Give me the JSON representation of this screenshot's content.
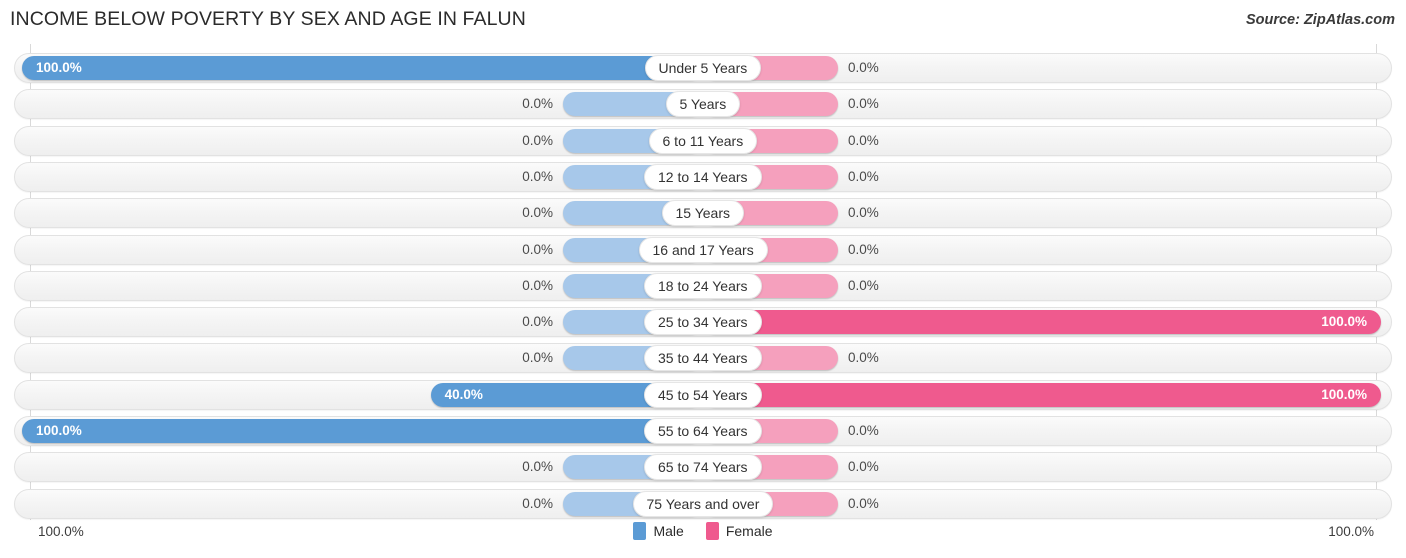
{
  "header": {
    "title": "INCOME BELOW POVERTY BY SEX AND AGE IN FALUN",
    "source": "Source: ZipAtlas.com"
  },
  "footer": {
    "axis_min_label": "100.0%",
    "axis_max_label": "100.0%",
    "legend": [
      {
        "label": "Male",
        "color": "#5b9bd5"
      },
      {
        "label": "Female",
        "color": "#ef5a8e"
      }
    ]
  },
  "chart_data": {
    "type": "bar",
    "title": "INCOME BELOW POVERTY BY SEX AND AGE IN FALUN",
    "subtitle": "Source: ZipAtlas.com",
    "orientation": "horizontal-diverging",
    "xlabel": "",
    "ylabel": "",
    "xlim": [
      100.0,
      100.0
    ],
    "grid": false,
    "legend_position": "bottom-center",
    "categories": [
      "Under 5 Years",
      "5 Years",
      "6 to 11 Years",
      "12 to 14 Years",
      "15 Years",
      "16 and 17 Years",
      "18 to 24 Years",
      "25 to 34 Years",
      "35 to 44 Years",
      "45 to 54 Years",
      "55 to 64 Years",
      "65 to 74 Years",
      "75 Years and over"
    ],
    "series": [
      {
        "name": "Male",
        "color": "#5b9bd5",
        "values": [
          100.0,
          0.0,
          0.0,
          0.0,
          0.0,
          0.0,
          0.0,
          0.0,
          0.0,
          40.0,
          100.0,
          0.0,
          0.0
        ],
        "labels": [
          "100.0%",
          "0.0%",
          "0.0%",
          "0.0%",
          "0.0%",
          "0.0%",
          "0.0%",
          "0.0%",
          "0.0%",
          "40.0%",
          "100.0%",
          "0.0%",
          "0.0%"
        ]
      },
      {
        "name": "Female",
        "color": "#ef5a8e",
        "values": [
          0.0,
          0.0,
          0.0,
          0.0,
          0.0,
          0.0,
          0.0,
          100.0,
          0.0,
          100.0,
          0.0,
          0.0,
          0.0
        ],
        "labels": [
          "0.0%",
          "0.0%",
          "0.0%",
          "0.0%",
          "0.0%",
          "0.0%",
          "0.0%",
          "100.0%",
          "0.0%",
          "100.0%",
          "0.0%",
          "0.0%",
          "0.0%"
        ]
      }
    ]
  }
}
